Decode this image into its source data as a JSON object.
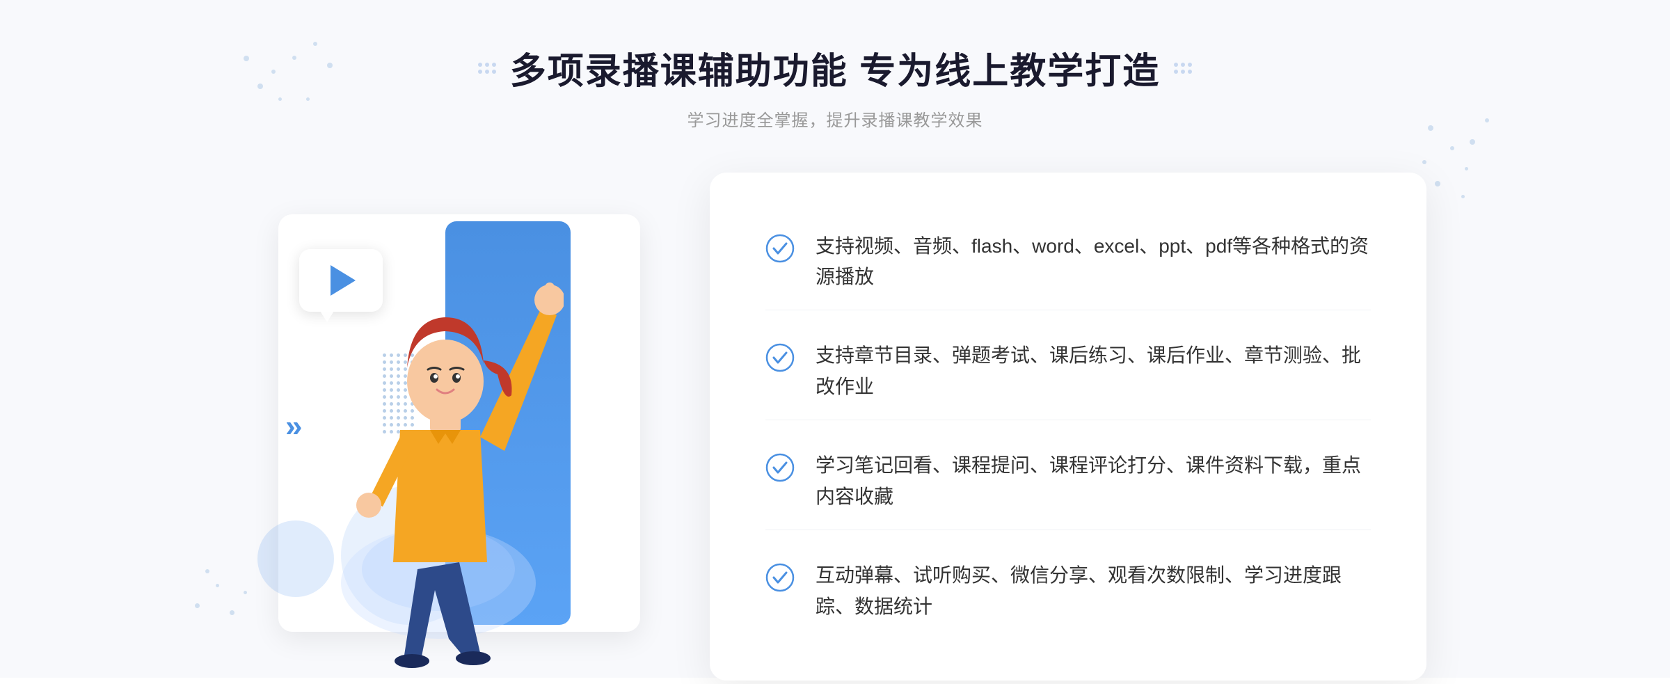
{
  "header": {
    "title": "多项录播课辅助功能 专为线上教学打造",
    "subtitle": "学习进度全掌握，提升录播课教学效果",
    "decorative_dots_label": "dots"
  },
  "features": [
    {
      "id": "feature-1",
      "text": "支持视频、音频、flash、word、excel、ppt、pdf等各种格式的资源播放"
    },
    {
      "id": "feature-2",
      "text": "支持章节目录、弹题考试、课后练习、课后作业、章节测验、批改作业"
    },
    {
      "id": "feature-3",
      "text": "学习笔记回看、课程提问、课程评论打分、课件资料下载，重点内容收藏"
    },
    {
      "id": "feature-4",
      "text": "互动弹幕、试听购买、微信分享、观看次数限制、学习进度跟踪、数据统计"
    }
  ],
  "colors": {
    "primary_blue": "#4a90e2",
    "light_blue": "#5ba3f5",
    "check_circle": "#4a90e2",
    "text_dark": "#1a1a2e",
    "text_medium": "#333333",
    "text_light": "#999999",
    "bg_light": "#f8f9fc",
    "white": "#ffffff"
  },
  "illustration": {
    "play_label": "play",
    "arrows_label": "navigation arrows"
  }
}
